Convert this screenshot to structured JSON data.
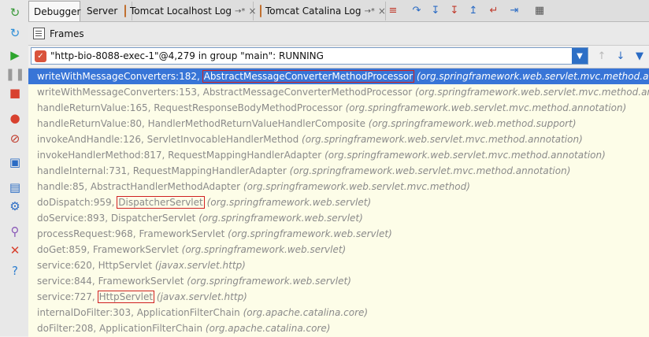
{
  "tabs": [
    {
      "label": "Debugger",
      "active": true
    },
    {
      "label": "Server",
      "active": false
    },
    {
      "label": "Tomcat Localhost Log",
      "pin": "→*",
      "close": "×",
      "active": false
    },
    {
      "label": "Tomcat Catalina Log",
      "pin": "→*",
      "close": "×",
      "active": false
    }
  ],
  "toolbar_icons": [
    "show-execution-point-icon",
    "step-over-icon",
    "step-into-icon",
    "force-step-into-icon",
    "step-out-icon",
    "drop-frame-icon",
    "run-to-cursor-icon",
    "evaluate-expression-icon"
  ],
  "left_toolbar_icons": [
    "rerun-icon",
    "resume-icon",
    "pause-icon",
    "stop-icon",
    "view-breakpoints-icon",
    "mute-breakpoints-icon",
    "snapshot-icon",
    "restore-layout-icon",
    "settings-icon",
    "pin-icon",
    "close-icon",
    "help-icon"
  ],
  "frames_panel": {
    "title": "Frames"
  },
  "thread": {
    "label": "\"http-bio-8088-exec-1\"@4,279 in group \"main\": RUNNING"
  },
  "frames": [
    {
      "prefix": "writeWithMessageConverters:182, ",
      "cls": "AbstractMessageConverterMethodProcessor",
      "pkg": "(org.springframework.web.servlet.mvc.method.annotation)",
      "highlight": true,
      "selected": true
    },
    {
      "prefix": "writeWithMessageConverters:153, ",
      "cls": "AbstractMessageConverterMethodProcessor",
      "pkg": "(org.springframework.web.servlet.mvc.method.annotation)",
      "highlight": false,
      "selected": false
    },
    {
      "prefix": "handleReturnValue:165, ",
      "cls": "RequestResponseBodyMethodProcessor",
      "pkg": "(org.springframework.web.servlet.mvc.method.annotation)",
      "highlight": false,
      "selected": false
    },
    {
      "prefix": "handleReturnValue:80, ",
      "cls": "HandlerMethodReturnValueHandlerComposite",
      "pkg": "(org.springframework.web.method.support)",
      "highlight": false,
      "selected": false
    },
    {
      "prefix": "invokeAndHandle:126, ",
      "cls": "ServletInvocableHandlerMethod",
      "pkg": "(org.springframework.web.servlet.mvc.method.annotation)",
      "highlight": false,
      "selected": false
    },
    {
      "prefix": "invokeHandlerMethod:817, ",
      "cls": "RequestMappingHandlerAdapter",
      "pkg": "(org.springframework.web.servlet.mvc.method.annotation)",
      "highlight": false,
      "selected": false
    },
    {
      "prefix": "handleInternal:731, ",
      "cls": "RequestMappingHandlerAdapter",
      "pkg": "(org.springframework.web.servlet.mvc.method.annotation)",
      "highlight": false,
      "selected": false
    },
    {
      "prefix": "handle:85, ",
      "cls": "AbstractHandlerMethodAdapter",
      "pkg": "(org.springframework.web.servlet.mvc.method)",
      "highlight": false,
      "selected": false
    },
    {
      "prefix": "doDispatch:959, ",
      "cls": "DispatcherServlet",
      "pkg": "(org.springframework.web.servlet)",
      "highlight": true,
      "selected": false
    },
    {
      "prefix": "doService:893, ",
      "cls": "DispatcherServlet",
      "pkg": "(org.springframework.web.servlet)",
      "highlight": false,
      "selected": false
    },
    {
      "prefix": "processRequest:968, ",
      "cls": "FrameworkServlet",
      "pkg": "(org.springframework.web.servlet)",
      "highlight": false,
      "selected": false
    },
    {
      "prefix": "doGet:859, ",
      "cls": "FrameworkServlet",
      "pkg": "(org.springframework.web.servlet)",
      "highlight": false,
      "selected": false
    },
    {
      "prefix": "service:620, ",
      "cls": "HttpServlet",
      "pkg": "(javax.servlet.http)",
      "highlight": false,
      "selected": false
    },
    {
      "prefix": "service:844, ",
      "cls": "FrameworkServlet",
      "pkg": "(org.springframework.web.servlet)",
      "highlight": false,
      "selected": false
    },
    {
      "prefix": "service:727, ",
      "cls": "HttpServlet",
      "pkg": "(javax.servlet.http)",
      "highlight": true,
      "selected": false
    },
    {
      "prefix": "internalDoFilter:303, ",
      "cls": "ApplicationFilterChain",
      "pkg": "(org.apache.catalina.core)",
      "highlight": false,
      "selected": false
    },
    {
      "prefix": "doFilter:208, ",
      "cls": "ApplicationFilterChain",
      "pkg": "(org.apache.catalina.core)",
      "highlight": false,
      "selected": false
    }
  ]
}
